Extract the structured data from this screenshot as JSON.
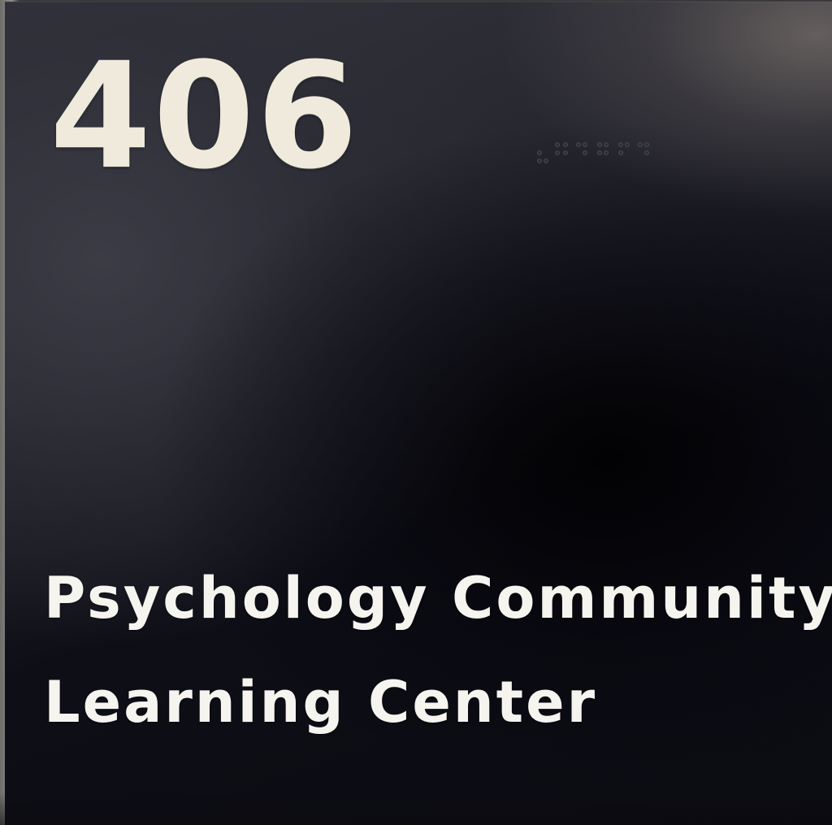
{
  "sign": {
    "room_number": "406",
    "room_name_line1": "Psychology Community",
    "room_name_line2": "Learning Center",
    "background_color": "#14141c",
    "text_color": "#f6f4ef",
    "number_color": "#efeadb"
  }
}
